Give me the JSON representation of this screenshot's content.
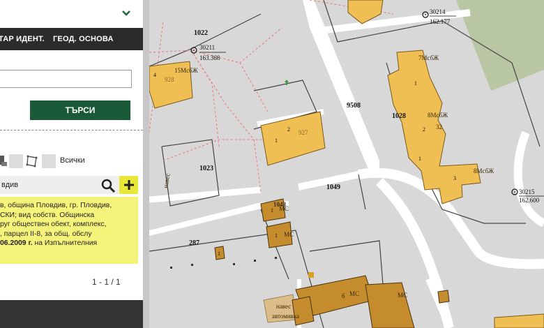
{
  "sidebar": {
    "tabs": [
      "ТАР ИДЕНТ.",
      "ГЕОД. ОСНОВА"
    ],
    "search_button": "ТЪРСИ",
    "filter_all_label": "Всички",
    "search_row_text": "вдив",
    "result_lines": [
      "в, община Пловдив, гр. Пловдив,",
      "СКИ; вид собств. Общинска",
      "руг обществен обект, комплекс,",
      ", парцел II-8, за общ. обслу",
      "06.2009 г. на Изпълнителния"
    ],
    "pager": "1 - 1 / 1"
  },
  "map": {
    "parcels": [
      "1022",
      "1023",
      "1028",
      "1049",
      "9508",
      "287"
    ],
    "survey_points": [
      {
        "id": "30211",
        "elev": "163.368"
      },
      {
        "id": "30214",
        "elev": "162.177"
      },
      {
        "id": "30215",
        "elev": "162.600"
      }
    ],
    "building_labels": [
      "928",
      "927",
      "15МсбЖ",
      "7МсбЖ",
      "8МсбЖ",
      "8МсбЖ",
      "32",
      "1048",
      "МС",
      "МС",
      "МС",
      "6",
      "навес",
      "навес",
      "автомивка",
      "МС"
    ],
    "colors": {
      "building": "#f0bf54",
      "building_dark": "#c58c2d",
      "road": "#ffffff",
      "ground": "#d8d8d8",
      "park": "#b9c7a6",
      "dashed_line": "#f07a7a"
    }
  }
}
